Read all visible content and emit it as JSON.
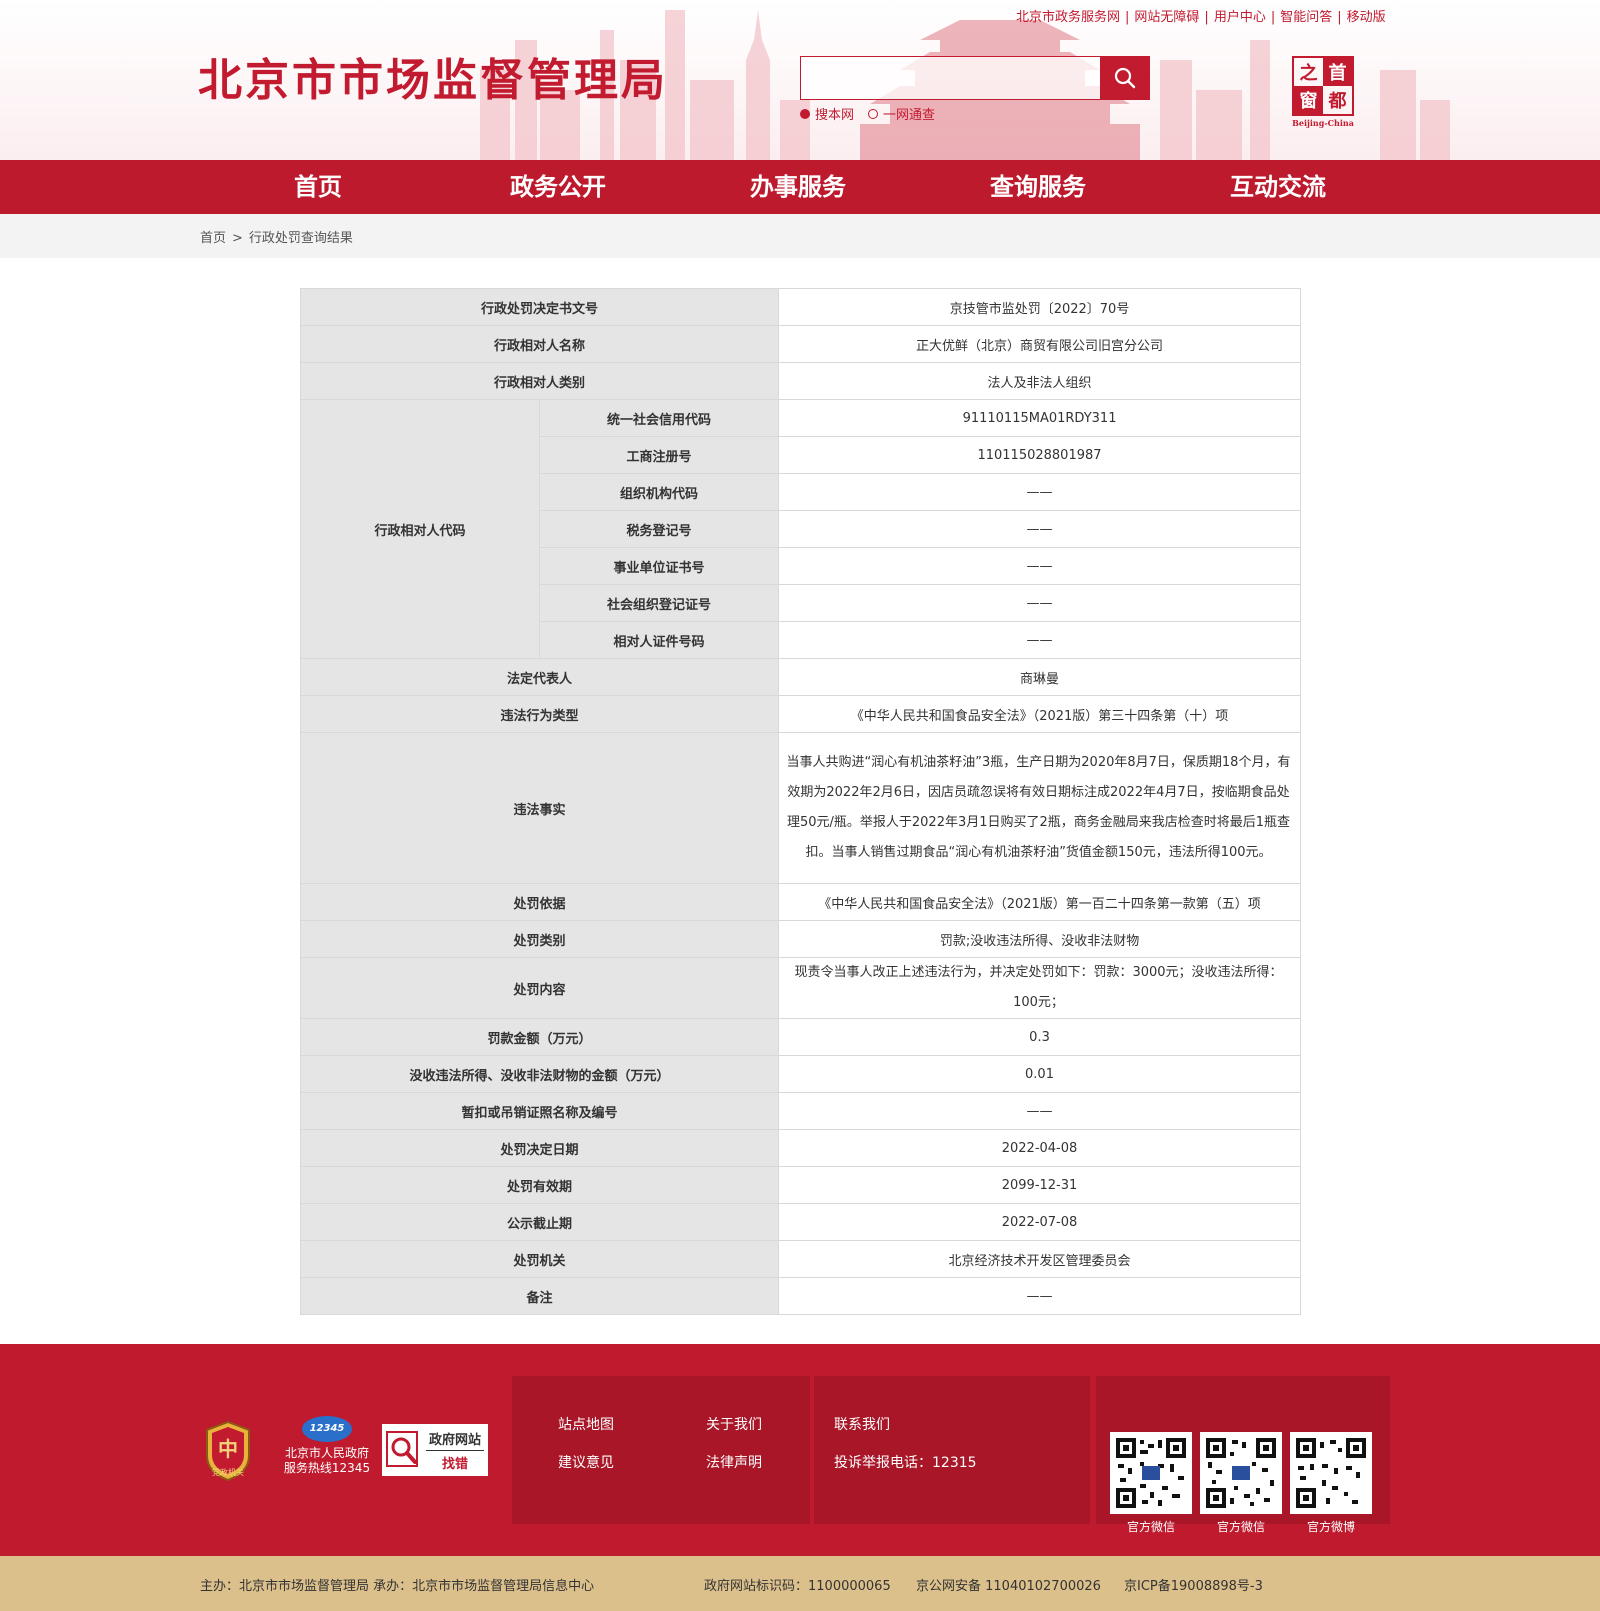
{
  "header": {
    "site_title": "北京市市场监督管理局",
    "top_links": [
      "北京市政务服务网",
      "网站无障碍",
      "用户中心",
      "智能问答",
      "移动版"
    ],
    "search": {
      "placeholder": "",
      "scope_options": [
        "搜本网",
        "一网通查"
      ],
      "selected_scope": "搜本网"
    },
    "capital_logo": {
      "chars": [
        "之",
        "首",
        "窗",
        "都"
      ],
      "caption": "Beijing-China"
    }
  },
  "nav": [
    "首页",
    "政务公开",
    "办事服务",
    "查询服务",
    "互动交流"
  ],
  "breadcrumb": {
    "home": "首页",
    "separator": ">",
    "current": "行政处罚查询结果"
  },
  "record": {
    "decision_no": {
      "label": "行政处罚决定书文号",
      "value": "京技管市监处罚〔2022〕70号"
    },
    "party_name": {
      "label": "行政相对人名称",
      "value": "正大优鲜（北京）商贸有限公司旧宫分公司"
    },
    "party_type": {
      "label": "行政相对人类别",
      "value": "法人及非法人组织"
    },
    "party_codes": {
      "label": "行政相对人代码",
      "items": [
        {
          "label": "统一社会信用代码",
          "value": "91110115MA01RDY311"
        },
        {
          "label": "工商注册号",
          "value": "110115028801987"
        },
        {
          "label": "组织机构代码",
          "value": "——"
        },
        {
          "label": "税务登记号",
          "value": "——"
        },
        {
          "label": "事业单位证书号",
          "value": "——"
        },
        {
          "label": "社会组织登记证号",
          "value": "——"
        },
        {
          "label": "相对人证件号码",
          "value": "——"
        }
      ]
    },
    "legal_rep": {
      "label": "法定代表人",
      "value": "商琳曼"
    },
    "violation_type": {
      "label": "违法行为类型",
      "value": "《中华人民共和国食品安全法》（2021版）第三十四条第（十）项"
    },
    "violation_facts": {
      "label": "违法事实",
      "value": "当事人共购进“润心有机油茶籽油”3瓶，生产日期为2020年8月7日，保质期18个月，有效期为2022年2月6日，因店员疏忽误将有效日期标注成2022年4月7日，按临期食品处理50元/瓶。举报人于2022年3月1日购买了2瓶，商务金融局来我店检查时将最后1瓶查扣。当事人销售过期食品“润心有机油茶籽油”货值金额150元，违法所得100元。"
    },
    "penalty_basis": {
      "label": "处罚依据",
      "value": "《中华人民共和国食品安全法》（2021版）第一百二十四条第一款第（五）项"
    },
    "penalty_category": {
      "label": "处罚类别",
      "value": "罚款;没收违法所得、没收非法财物"
    },
    "penalty_content": {
      "label": "处罚内容",
      "value": "现责令当事人改正上述违法行为，并决定处罚如下：罚款：3000元；没收违法所得：100元；"
    },
    "fine_amount": {
      "label": "罚款金额（万元）",
      "value": "0.3"
    },
    "confiscated_amount": {
      "label": "没收违法所得、没收非法财物的金额（万元）",
      "value": "0.01"
    },
    "license_suspension": {
      "label": "暂扣或吊销证照名称及编号",
      "value": "——"
    },
    "decision_date": {
      "label": "处罚决定日期",
      "value": "2022-04-08"
    },
    "valid_until": {
      "label": "处罚有效期",
      "value": "2099-12-31"
    },
    "publicity_deadline": {
      "label": "公示截止期",
      "value": "2022-07-08"
    },
    "authority": {
      "label": "处罚机关",
      "value": "北京经济技术开发区管理委员会"
    },
    "remarks": {
      "label": "备注",
      "value": "——"
    }
  },
  "footer": {
    "party_badge_text": "党政机关",
    "hotline": {
      "logo": "12345",
      "line1": "北京市人民政府",
      "line2": "服务热线12345"
    },
    "gov_error": {
      "line1": "政府网站",
      "line2": "找错"
    },
    "links": [
      "站点地图",
      "关于我们",
      "建议意见",
      "法律声明"
    ],
    "contact": {
      "label": "联系我们",
      "phone": "投诉举报电话：12315"
    },
    "qr_labels": [
      "官方微信",
      "官方微信",
      "官方微博"
    ],
    "bottom": {
      "sponsor": "主办：北京市市场监督管理局  承办：北京市市场监督管理局信息中心",
      "site_id": "政府网站标识码：1100000065",
      "police": "京公网安备 11040102700026",
      "icp": "京ICP备19008898号-3"
    }
  },
  "colors": {
    "brand_red": "#be1a2e",
    "footer_panel": "#a81628",
    "bottom_bar": "#dcc08c"
  }
}
